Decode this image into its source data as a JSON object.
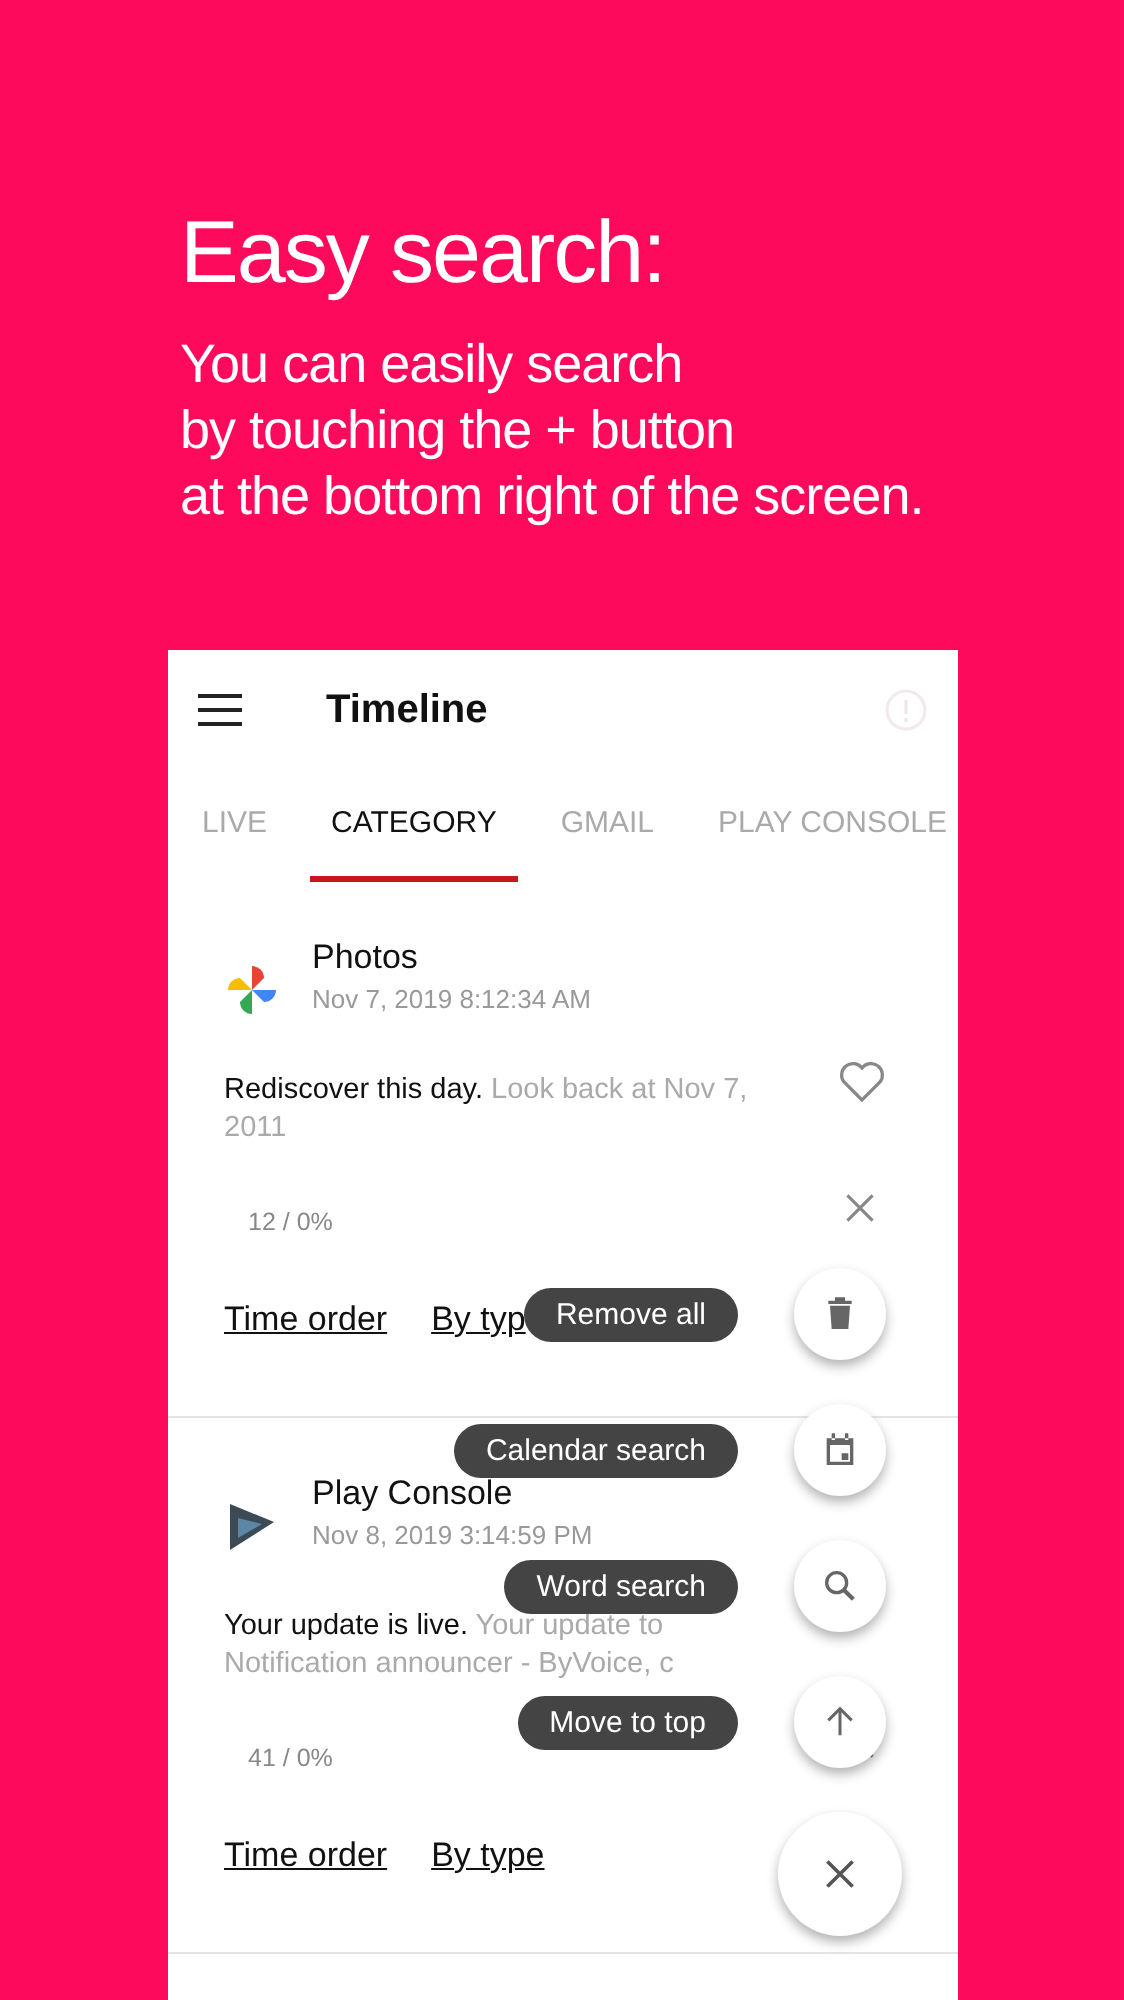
{
  "headline": {
    "title": "Easy search:",
    "lines": [
      "You can easily search",
      "by touching the + button",
      "at the bottom right of the screen."
    ]
  },
  "app_bar": {
    "title": "Timeline"
  },
  "tabs": [
    {
      "label": "LIVE",
      "selected": false
    },
    {
      "label": "CATEGORY",
      "selected": true
    },
    {
      "label": "GMAIL",
      "selected": false
    },
    {
      "label": "PLAY CONSOLE",
      "selected": false
    }
  ],
  "cards": [
    {
      "app": "Photos",
      "kind": "pinwheel",
      "time": "Nov 7, 2019 8:12:34 AM",
      "title": "Rediscover this day.",
      "detail": "Look back at Nov 7, 2011",
      "liked": false,
      "count": "12 / 0%",
      "links": [
        "Time order",
        "By typ"
      ]
    },
    {
      "app": "Play Console",
      "kind": "play",
      "time": "Nov 8, 2019 3:14:59 PM",
      "title": "Your update is live.",
      "detail": "Your update to Notification announcer - ByVoice, c",
      "count": "41 / 0%",
      "links": [
        "Time order",
        "By type"
      ]
    }
  ],
  "speed_dial": {
    "actions": [
      {
        "label": "Remove all",
        "kind": "trash"
      },
      {
        "label": "Calendar search",
        "kind": "calendar"
      },
      {
        "label": "Word search",
        "kind": "search"
      },
      {
        "label": "Move to top",
        "kind": "up"
      }
    ]
  }
}
